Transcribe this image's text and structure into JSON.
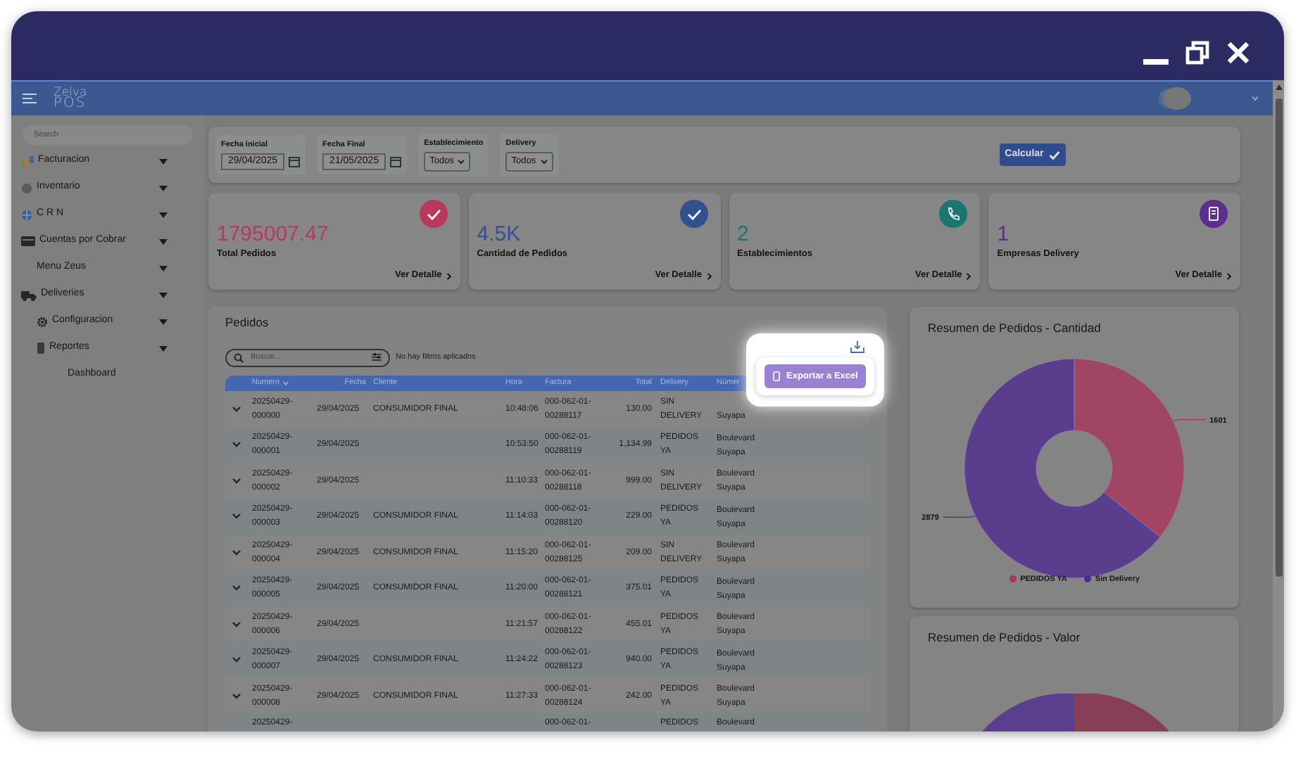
{
  "header": {
    "logo_top": "Zelva",
    "logo_bottom": "POS"
  },
  "sidebar": {
    "search": {
      "placeholder": "Search"
    },
    "items": [
      {
        "label": "Facturacion",
        "kind": "group"
      },
      {
        "label": "Inventario",
        "kind": "group"
      },
      {
        "label": "C R N",
        "kind": "group"
      },
      {
        "label": "Cuentas por Cobrar",
        "kind": "group",
        "children": [
          {
            "label": "Menu Zeus",
            "kind": "group"
          }
        ]
      },
      {
        "label": "Deliveries",
        "kind": "group",
        "children": [
          {
            "label": "Configuracion",
            "kind": "group"
          },
          {
            "label": "Reportes",
            "kind": "group",
            "children": [
              {
                "label": "Dashboard",
                "kind": "link"
              }
            ]
          }
        ]
      }
    ]
  },
  "filters": [
    {
      "label": "Fecha inicial",
      "kind": "date",
      "value": "29/04/2025"
    },
    {
      "label": "Fecha Final",
      "kind": "date",
      "value": "21/05/2025"
    },
    {
      "label": "Establecimiento",
      "kind": "select",
      "value": "Todos"
    },
    {
      "label": "Delivery",
      "kind": "select",
      "value": "Todos"
    }
  ],
  "calculate_button": "Calcular",
  "stats": [
    {
      "value": "1795007.47",
      "label": "Total Pedidos",
      "link": "Ver Detalle",
      "color": "#b8395c"
    },
    {
      "value": "4.5K",
      "label": "Cantidad de Pedidos",
      "link": "Ver Detalle",
      "color": "#33508f"
    },
    {
      "value": "2",
      "label": "Establecimientos",
      "link": "Ver Detalle",
      "color": "#1c7570"
    },
    {
      "value": "1",
      "label": "Empresas Delivery",
      "link": "Ver Detalle",
      "color": "#5b2e8f"
    }
  ],
  "orders": {
    "title": "Pedidos",
    "search": {
      "placeholder": "Buscar..."
    },
    "filter_status": "No hay filtros aplicados",
    "export_button": "Exportar a Excel",
    "columns": [
      "Numero",
      "Fecha",
      "Cliente",
      "Hora",
      "Factura",
      "Total",
      "Delivery",
      "Númer"
    ],
    "rows": [
      {
        "kind": "full",
        "numero": "20250429-000000",
        "fecha": "29/04/2025",
        "cliente": "CONSUMIDOR FINAL",
        "hora": "10:48:06",
        "factura": "000-062-01-00288117",
        "total": "130.00",
        "delivery": "SIN DELIVERY",
        "establecimiento": "Suyapa"
      },
      {
        "kind": "full",
        "numero": "20250429-000001",
        "fecha": "29/04/2025",
        "hora": "10:53:50",
        "factura": "000-062-01-00288119",
        "total": "1,134.99",
        "delivery": "PEDIDOS YA",
        "establecimiento": "Boulevard Suyapa"
      },
      {
        "kind": "full",
        "numero": "20250429-000002",
        "fecha": "29/04/2025",
        "hora": "11:10:33",
        "factura": "000-062-01-00288118",
        "total": "999.00",
        "delivery": "SIN DELIVERY",
        "establecimiento": "Boulevard Suyapa"
      },
      {
        "kind": "full",
        "numero": "20250429-000003",
        "fecha": "29/04/2025",
        "cliente": "CONSUMIDOR FINAL",
        "hora": "11:14:03",
        "factura": "000-062-01-00288120",
        "total": "229.00",
        "delivery": "PEDIDOS YA",
        "establecimiento": "Boulevard Suyapa"
      },
      {
        "kind": "full",
        "numero": "20250429-000004",
        "fecha": "29/04/2025",
        "cliente": "CONSUMIDOR FINAL",
        "hora": "11:15:20",
        "factura": "000-062-01-00288125",
        "total": "209.00",
        "delivery": "SIN DELIVERY",
        "establecimiento": "Boulevard Suyapa"
      },
      {
        "kind": "full",
        "numero": "20250429-000005",
        "fecha": "29/04/2025",
        "cliente": "CONSUMIDOR FINAL",
        "hora": "11:20:00",
        "factura": "000-062-01-00288121",
        "total": "375.01",
        "delivery": "PEDIDOS YA",
        "establecimiento": "Boulevard Suyapa"
      },
      {
        "kind": "full",
        "numero": "20250429-000006",
        "fecha": "29/04/2025",
        "hora": "11:21:57",
        "factura": "000-062-01-00288122",
        "total": "455.01",
        "delivery": "PEDIDOS YA",
        "establecimiento": "Boulevard Suyapa"
      },
      {
        "kind": "full",
        "numero": "20250429-000007",
        "fecha": "29/04/2025",
        "cliente": "CONSUMIDOR FINAL",
        "hora": "11:24:22",
        "factura": "000-062-01-00288123",
        "total": "940.00",
        "delivery": "PEDIDOS YA",
        "establecimiento": "Boulevard Suyapa"
      },
      {
        "kind": "full",
        "numero": "20250429-000008",
        "fecha": "29/04/2025",
        "cliente": "CONSUMIDOR FINAL",
        "hora": "11:27:33",
        "factura": "000-062-01-00288124",
        "total": "242.00",
        "delivery": "PEDIDOS YA",
        "establecimiento": "Boulevard Suyapa"
      },
      {
        "kind": "cut",
        "numero": "20250429-",
        "factura": "000-062-01-",
        "delivery": "PEDIDOS",
        "establecimiento": "Boulevard"
      }
    ]
  },
  "charts": [
    {
      "title": "Resumen de Pedidos - Cantidad",
      "legend": [
        {
          "color": "#a8345a"
        },
        {
          "color": "#4f2a90"
        }
      ],
      "chart_data": {
        "type": "donut",
        "categories": [
          "PEDIDOS YA",
          "Sin Delivery"
        ],
        "values": [
          1601,
          2879
        ],
        "data_labels": true
      }
    },
    {
      "title": "Resumen de Pedidos - Valor"
    }
  ]
}
